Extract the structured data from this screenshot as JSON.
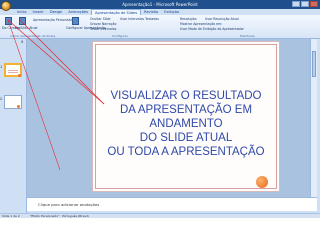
{
  "window": {
    "title": "Apresentação1 - Microsoft PowerPoint"
  },
  "tabs": [
    {
      "label": "Início"
    },
    {
      "label": "Inserir"
    },
    {
      "label": "Design"
    },
    {
      "label": "Animações"
    },
    {
      "label": "Apresentação de Slides"
    },
    {
      "label": "Revisão"
    },
    {
      "label": "Exibição"
    }
  ],
  "ribbon": {
    "from_start": "Do Começo",
    "from_current": "Do Slide Atual",
    "custom_show": "Apresentação Personalizada",
    "setup": "Configurar Apresentação",
    "hide_slide": "Ocultar Slide",
    "record_narration": "Gravar Narração",
    "rehearse": "Testar Intervalos",
    "use_timings": "Usar Intervalos Testados",
    "resolution": "Resolução:",
    "resolution_value": "Usar Resolução Atual",
    "show_on": "Mostrar Apresentação em:",
    "presenter_view": "Usar Modo de Exibição do Apresentador",
    "group_start": "Iniciar Apresentação de Slides",
    "group_config": "Configurar",
    "group_monitors": "Monitores"
  },
  "slides_panel": {
    "close": "x",
    "slide_numbers": [
      "1",
      "2"
    ]
  },
  "slide": {
    "lines": [
      "VISUALIZAR O RESULTADO",
      "DA APRESENTAÇÃO EM",
      "ANDAMENTO",
      "DO SLIDE ATUAL",
      "OU TODA A APRESENTAÇÃO"
    ]
  },
  "notes": {
    "placeholder": "Clique para adicionar anotações"
  },
  "status": {
    "slide_info": "Slide 1 de 2",
    "theme": "\"Efeito Escalonado\"",
    "language": "Português (Brasil)"
  },
  "colors": {
    "title_bar": "#1f4f8c",
    "slide_text": "#2f49a9",
    "accent_orange": "#e57b2c",
    "arrow_red": "#e0303a"
  }
}
